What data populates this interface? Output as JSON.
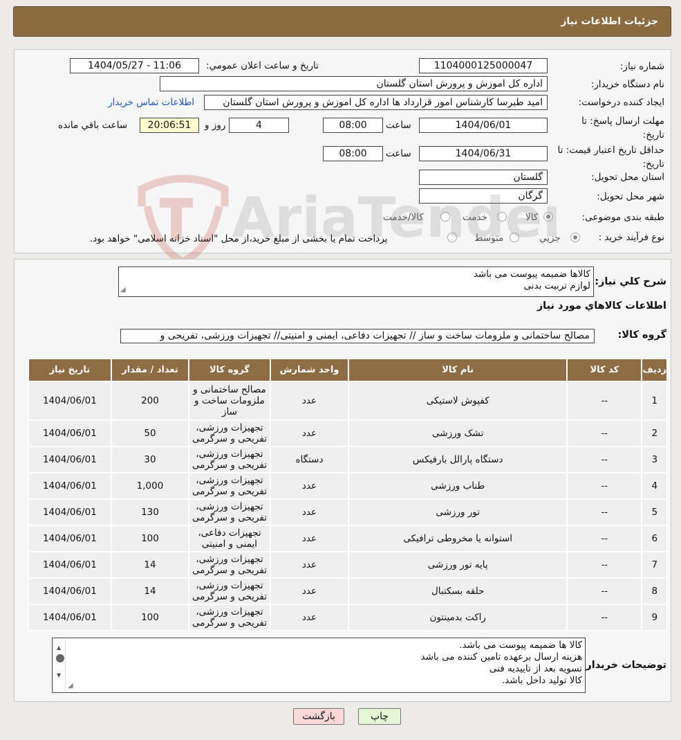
{
  "header": {
    "title": "جزئیات اطلاعات نیاز"
  },
  "info": {
    "need_number_label": "شماره نیاز:",
    "need_number": "1104000125000047",
    "announce_label": "تاریخ و ساعت اعلان عمومي:",
    "announce_value": "1404/05/27 - 11:06",
    "buyer_label": "نام دستگاه خریدار:",
    "buyer_value": "اداره کل اموزش و پرورش استان گلستان",
    "creator_label": "ایجاد کننده درخواست:",
    "creator_value": "امید طبرسا کارشناس امور قرارداد ها اداره کل اموزش و پرورش استان گلستان",
    "contact_link": "اطلاعات تماس خریدار",
    "deadline_label": "مهلت ارسال پاسخ: تا تاریخ:",
    "deadline_date": "1404/06/01",
    "time_word": "ساعت",
    "deadline_time": "08:00",
    "days_value": "4",
    "days_word": "روز و",
    "remaining_time": "20:06:51",
    "remaining_word": "ساعت باقي مانده",
    "validity_label": "حداقل تاریخ اعتبار قیمت: تا تاریخ:",
    "validity_date": "1404/06/31",
    "validity_time": "08:00",
    "province_label": "استان محل تحویل:",
    "province_value": "گلستان",
    "city_label": "شهر محل تحویل:",
    "city_value": "گرگان",
    "category_label": "طبقه بندی موضوعی:",
    "category_options": [
      "کالا",
      "خدمت",
      "کالا/خدمت"
    ],
    "category_selected": "کالا",
    "process_label": "نوع فرآیند خرید :",
    "process_options": [
      "جزیي",
      "متوسط"
    ],
    "process_selected": "جزیي",
    "process_note": "پرداخت تمام یا بخشی از مبلغ خرید،از محل \"اسناد خزانه اسلامی\" خواهد بود."
  },
  "items_section": {
    "summary_label": "شرح کلي نیاز:",
    "summary_lines": [
      "کالاها ضمیمه پیوست می باشد",
      "لوازم تربیت بدنی"
    ],
    "section_title": "اطلاعات کالاهاي مورد نیاز",
    "group_label": "گروه کالا:",
    "group_value": "مصالح ساختمانی و ملزومات ساخت و ساز // تجهیزات دفاعی، ایمنی و امنیتی// تجهیزات ورزشی، تفریحی و",
    "table": {
      "headers": [
        "ردیف",
        "کد کالا",
        "نام کالا",
        "واحد شمارش",
        "گروه کالا",
        "تعداد / مقدار",
        "تاریخ نیاز"
      ],
      "rows": [
        [
          "1",
          "--",
          "کفپوش لاستیکی",
          "عدد",
          "مصالح ساختمانی و ملزومات ساخت و ساز",
          "200",
          "1404/06/01"
        ],
        [
          "2",
          "--",
          "تشک ورزشی",
          "عدد",
          "تجهیزات ورزشی، تفریحی و سرگرمی",
          "50",
          "1404/06/01"
        ],
        [
          "3",
          "--",
          "دستگاه پارالل بارفیکس",
          "دستگاه",
          "تجهیزات ورزشی، تفریحی و سرگرمی",
          "30",
          "1404/06/01"
        ],
        [
          "4",
          "--",
          "طناب ورزشی",
          "عدد",
          "تجهیزات ورزشی، تفریحی و سرگرمی",
          "1,000",
          "1404/06/01"
        ],
        [
          "5",
          "--",
          "تور ورزشی",
          "عدد",
          "تجهیزات ورزشی، تفریحی و سرگرمی",
          "130",
          "1404/06/01"
        ],
        [
          "6",
          "--",
          "استوانه یا مخروطی ترافیکی",
          "عدد",
          "تجهیزات دفاعی، ایمنی و امنیتی",
          "100",
          "1404/06/01"
        ],
        [
          "7",
          "--",
          "پایه تور ورزشی",
          "عدد",
          "تجهیزات ورزشی، تفریحی و سرگرمی",
          "14",
          "1404/06/01"
        ],
        [
          "8",
          "--",
          "حلقه بسکتبال",
          "عدد",
          "تجهیزات ورزشی، تفریحی و سرگرمی",
          "14",
          "1404/06/01"
        ],
        [
          "9",
          "--",
          "راکت بدمینتون",
          "عدد",
          "تجهیزات ورزشی، تفریحی و سرگرمی",
          "100",
          "1404/06/01"
        ]
      ]
    },
    "buyer_notes_label": "توضیحات خریدار:",
    "buyer_notes_lines": [
      "کالا ها ضمیمه پیوست می باشد.",
      "هزینه ارسال برعهده تامین کننده می باشد",
      "تسویه بعد از تاییدیه فنی",
      "کالا تولید داخل باشد."
    ]
  },
  "buttons": {
    "back": "بازگشت",
    "print": "چاپ"
  },
  "watermark": {
    "text": "AriaTender.neT"
  }
}
